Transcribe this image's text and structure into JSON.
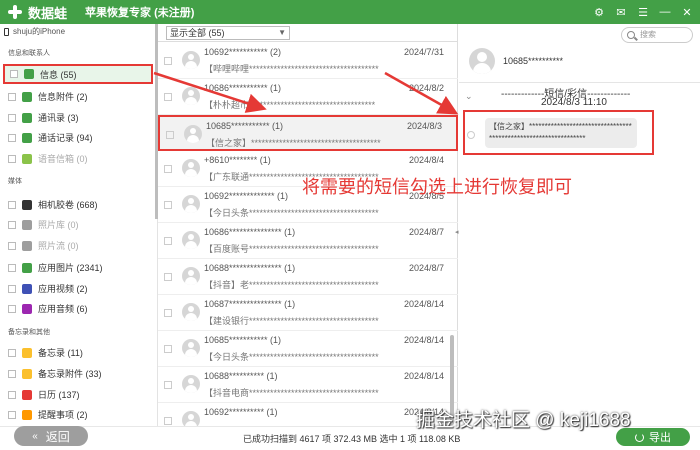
{
  "titlebar": {
    "logo_text": "数据蛙",
    "app_title": "苹果恢复专家 (未注册)"
  },
  "window_controls": [
    "⚙",
    "✉",
    "☰",
    "—",
    "✕"
  ],
  "device": "shuju的iPhone",
  "sections": [
    "信息和联系人",
    "媒体",
    "备忘录和其他"
  ],
  "categories": [
    {
      "label": "信息 (55)",
      "icon": "message-icon",
      "color": "#43a047"
    },
    {
      "label": "信息附件 (2)",
      "icon": "attachment-icon",
      "color": "#43a047"
    },
    {
      "label": "通讯录 (3)",
      "icon": "contacts-icon",
      "color": "#43a047"
    },
    {
      "label": "通话记录 (94)",
      "icon": "phone-icon",
      "color": "#43a047"
    },
    {
      "label": "语音信箱 (0)",
      "icon": "voicemail-icon",
      "color": "#8bc34a"
    },
    {
      "label": "相机胶卷 (668)",
      "icon": "camera-icon",
      "color": "#333333"
    },
    {
      "label": "照片库 (0)",
      "icon": "photo-library-icon",
      "color": "#9e9e9e"
    },
    {
      "label": "照片流 (0)",
      "icon": "photo-stream-icon",
      "color": "#9e9e9e"
    },
    {
      "label": "应用图片 (2341)",
      "icon": "app-photo-icon",
      "color": "#43a047"
    },
    {
      "label": "应用视频 (2)",
      "icon": "app-video-icon",
      "color": "#3f51b5"
    },
    {
      "label": "应用音频 (6)",
      "icon": "app-audio-icon",
      "color": "#9c27b0"
    },
    {
      "label": "备忘录 (11)",
      "icon": "notes-icon",
      "color": "#fbc02d"
    },
    {
      "label": "备忘录附件 (33)",
      "icon": "notes-attachment-icon",
      "color": "#fbc02d"
    },
    {
      "label": "日历 (137)",
      "icon": "calendar-icon",
      "color": "#e53935"
    },
    {
      "label": "提醒事项 (2)",
      "icon": "reminder-icon",
      "color": "#ff9800"
    }
  ],
  "back_button": "返回",
  "filter": "显示全部 (55)",
  "messages": [
    {
      "number": "10692*********** (2)",
      "date": "2024/7/31",
      "preview": "【哔哩哔哩*************************************"
    },
    {
      "number": "10686*********** (1)",
      "date": "2024/8/2",
      "preview": "【朴朴超市************************************"
    },
    {
      "number": "10685*********** (1)",
      "date": "2024/8/3",
      "preview": "【信之家】*************************************"
    },
    {
      "number": "+8610******** (1)",
      "date": "2024/8/4",
      "preview": "【广东联通*************************************"
    },
    {
      "number": "10692************* (1)",
      "date": "2024/8/5",
      "preview": "【今日头条*************************************"
    },
    {
      "number": "10686*************** (1)",
      "date": "2024/8/7",
      "preview": "【百度账号*************************************"
    },
    {
      "number": "10688*************** (1)",
      "date": "2024/8/7",
      "preview": "【抖音】老*************************************"
    },
    {
      "number": "10687*************** (1)",
      "date": "2024/8/14",
      "preview": "【建设银行*************************************"
    },
    {
      "number": "10685*********** (1)",
      "date": "2024/8/14",
      "preview": "【今日头条*************************************"
    },
    {
      "number": "10688********** (1)",
      "date": "2024/8/14",
      "preview": "【抖音电商*************************************"
    },
    {
      "number": "10692********** (1)",
      "date": "2024/8/14",
      "preview": "【今日头条*************************************"
    }
  ],
  "search_placeholder": "搜索",
  "detail": {
    "number": "10685**********",
    "type": "-------------短信/彩信-------------",
    "datetime": "2024/8/3 11:10",
    "bubble": "【信之家】****************************************************************"
  },
  "annotation": "将需要的短信勾选上进行恢复即可",
  "status": "已成功扫描到 4617 项 372.43 MB   选中 1 项 118.08 KB",
  "export_button": "导出",
  "watermark": "掘金技术社区 @ keji1688",
  "colors": {
    "brand": "#43a047",
    "highlight": "#e53935"
  }
}
